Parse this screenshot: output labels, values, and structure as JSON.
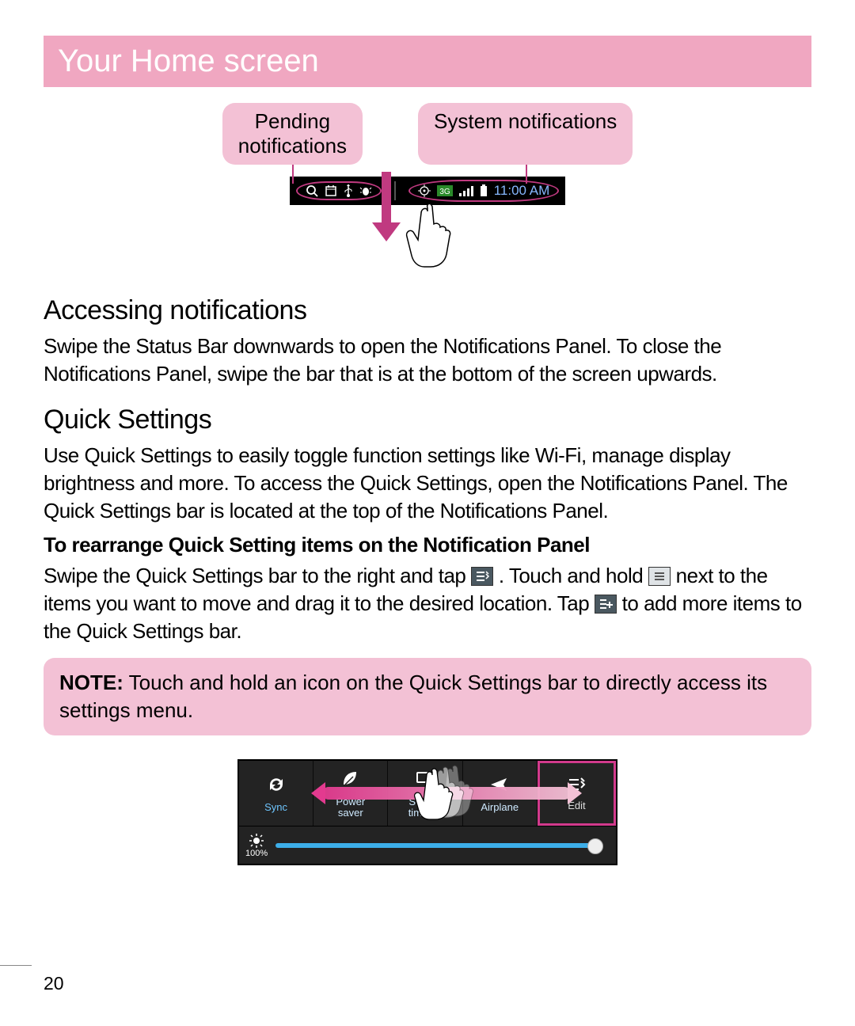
{
  "title": "Your Home screen",
  "callouts": {
    "pending": "Pending\nnotifications",
    "system": "System notifications"
  },
  "status_bar": {
    "time": "11:00 AM"
  },
  "sections": {
    "accessing_title": "Accessing notifications",
    "accessing_body": "Swipe the Status Bar downwards to open the Notifications Panel. To close the Notifications Panel, swipe the bar that is at the bottom of the screen upwards.",
    "quick_title": "Quick Settings",
    "quick_body": "Use Quick Settings to easily toggle function settings like Wi-Fi, manage display brightness and more. To access the Quick Settings, open the Notifications Panel. The Quick Settings bar is located at the top of the Notifications Panel.",
    "rearrange_bold": "To rearrange Quick Setting items on the Notification Panel",
    "rearrange_pt1": "Swipe the Quick Settings bar to the right and tap ",
    "rearrange_pt2": ". Touch and hold ",
    "rearrange_pt3": " next to the items you want to move and drag it to the desired location. Tap ",
    "rearrange_pt4": " to add more items to the Quick Settings bar."
  },
  "note": {
    "label": "NOTE:",
    "text": " Touch and hold an icon on the Quick Settings bar to directly access its settings menu."
  },
  "quick_settings_tiles": {
    "sync": "Sync",
    "power": "Power\nsaver",
    "screen": "Screen\ntimeout",
    "airplane": "Airplane",
    "edit": "Edit",
    "brightness_pct": "100%"
  },
  "page_number": "20"
}
